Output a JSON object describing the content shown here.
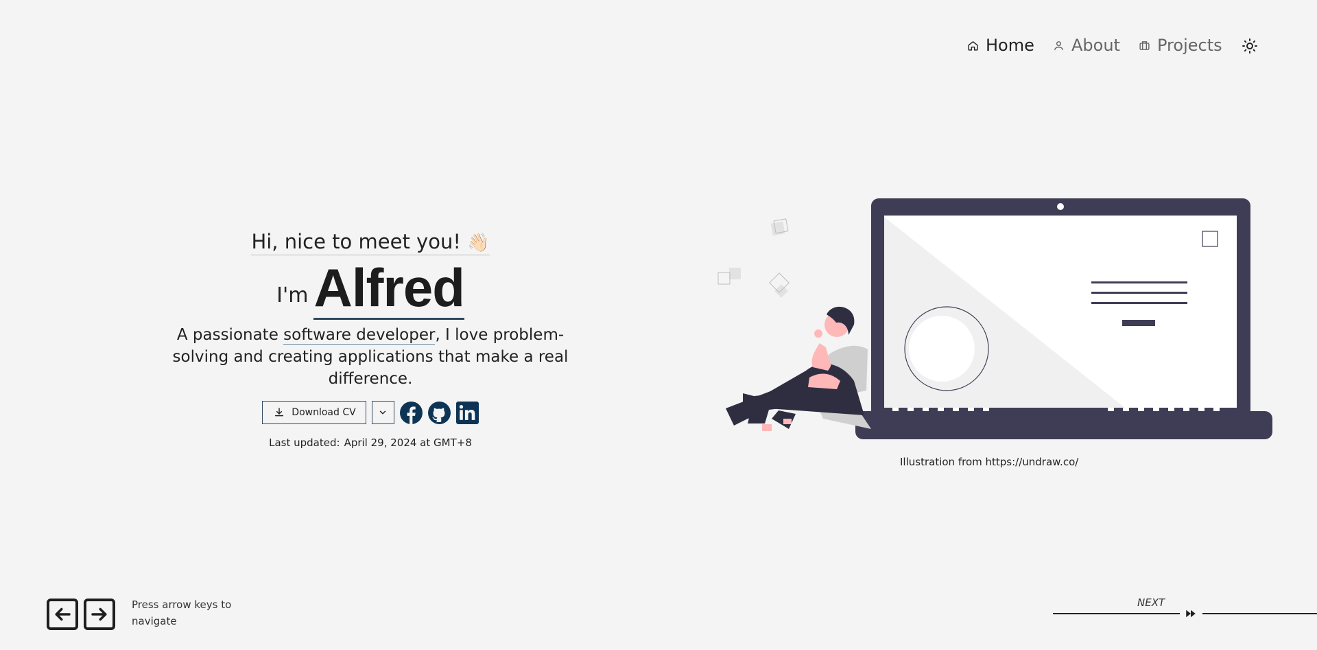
{
  "nav": {
    "home_label": "Home",
    "about_label": "About",
    "projects_label": "Projects",
    "active": "Home",
    "theme_toggle_icon": "sun-icon"
  },
  "hero": {
    "greeting": "Hi, nice to meet you!",
    "greeting_emoji": "👋🏻",
    "im_prefix": "I'm",
    "name": "Alfred",
    "tagline_before": "A passionate ",
    "tagline_highlight": "software developer",
    "tagline_after": ", I love problem-solving and creating applications that make a real difference.",
    "download_label": "Download CV",
    "download_icon": "download-icon",
    "dropdown_icon": "chevron-down-icon",
    "social_icons": [
      "facebook-icon",
      "github-icon",
      "linkedin-icon"
    ],
    "updated_label": "Last updated:",
    "updated_value": "April 29, 2024 at GMT+8"
  },
  "illustration": {
    "caption": "Illustration from https://undraw.co/"
  },
  "footer": {
    "key_icons": [
      "arrow-left-key-icon",
      "arrow-right-key-icon"
    ],
    "hint": "Press arrow keys to navigate",
    "next_label": "NEXT",
    "next_icon": "fast-forward-icon"
  },
  "colors": {
    "background": "#f4f4f4",
    "text": "#222222",
    "accent": "#2f4a62",
    "social": "#0e3455",
    "laptop": "#3f3d56",
    "skin": "#ffb8b8"
  }
}
